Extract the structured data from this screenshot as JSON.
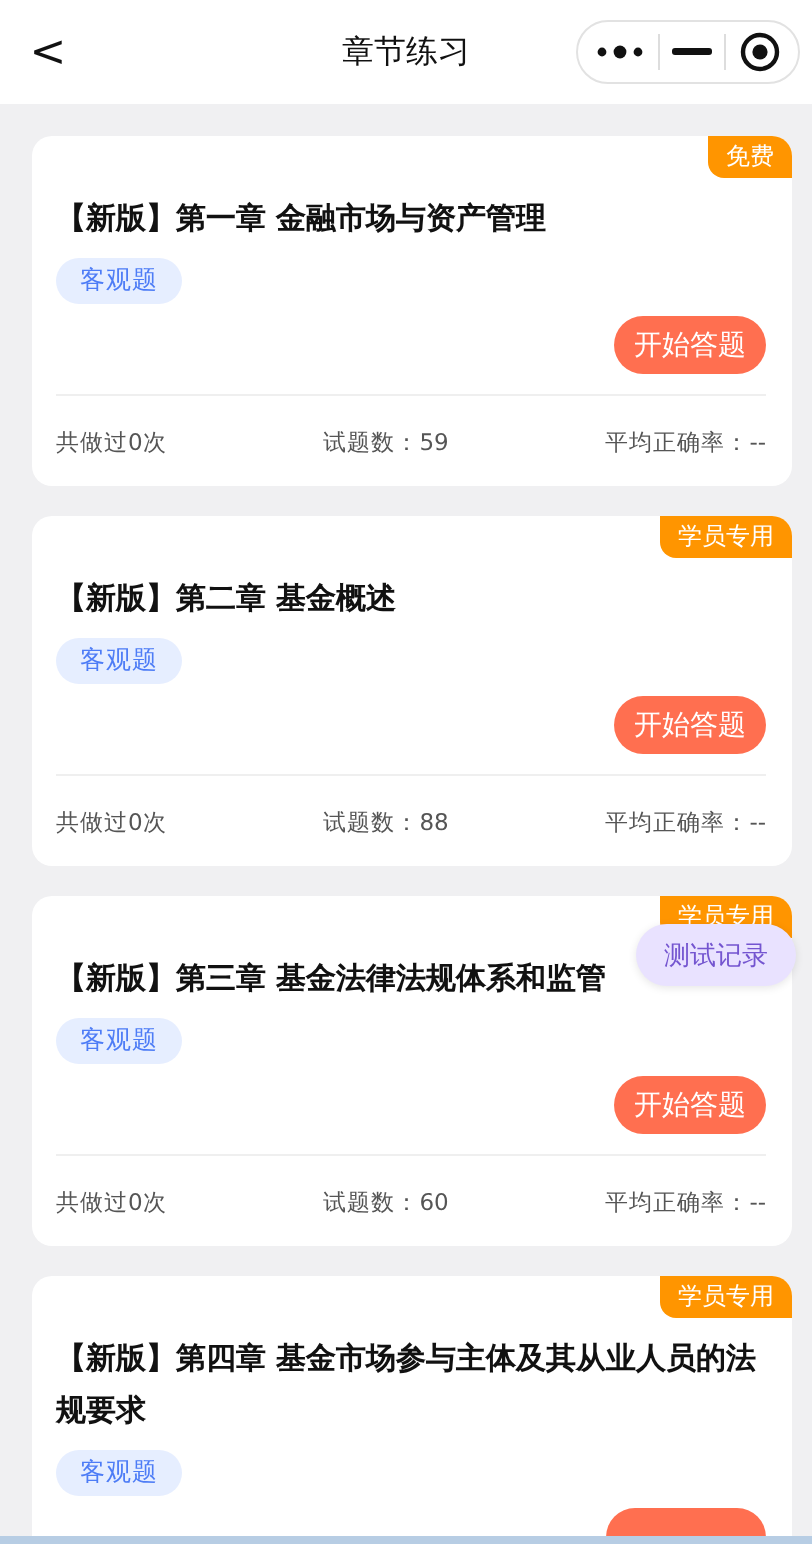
{
  "header": {
    "back": "<",
    "title": "章节练习"
  },
  "chapters": [
    {
      "badge": "免费",
      "title": "【新版】第一章 金融市场与资产管理",
      "tag": "客观题",
      "action": "开始答题",
      "done": "共做过0次",
      "count": "试题数：59",
      "accuracy": "平均正确率：--"
    },
    {
      "badge": "学员专用",
      "title": "【新版】第二章 基金概述",
      "tag": "客观题",
      "action": "开始答题",
      "done": "共做过0次",
      "count": "试题数：88",
      "accuracy": "平均正确率：--"
    },
    {
      "badge": "学员专用",
      "title": "【新版】第三章 基金法律法规体系和监管",
      "tag": "客观题",
      "action": "开始答题",
      "done": "共做过0次",
      "count": "试题数：60",
      "accuracy": "平均正确率：--"
    },
    {
      "badge": "学员专用",
      "title": "【新版】第四章 基金市场参与主体及其从业人员的法规要求",
      "tag": "客观题"
    }
  ],
  "floating_button": "测试记录"
}
